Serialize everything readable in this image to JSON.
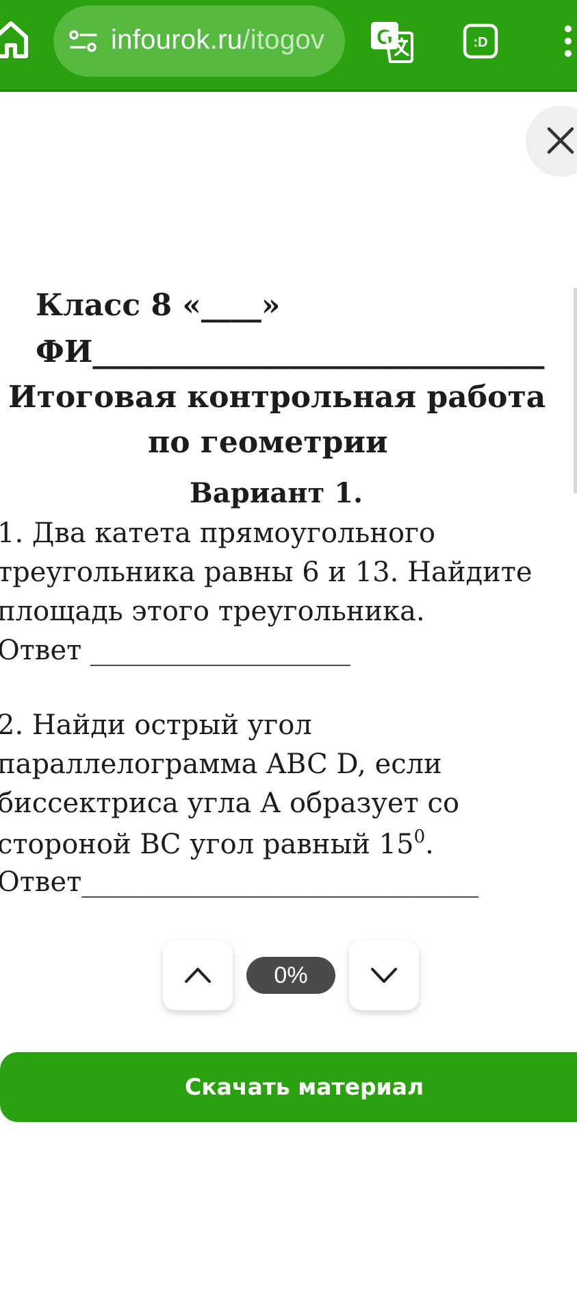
{
  "browser": {
    "url_domain": "infourok.ru",
    "url_path": "/itogov",
    "extension_label": ":D"
  },
  "document": {
    "class_line": "Класс 8 «____»",
    "name_line": "ФИ______________________________",
    "title_line1": "Итоговая контрольная работа",
    "title_line2": "по геометрии",
    "variant": "Вариант 1.",
    "q1_line1": "1.  Два катета прямоугольного",
    "q1_line2": "треугольника равны  6 и  13. Найдите",
    "q1_line3": "площадь этого треугольника.",
    "q1_answer": "Ответ ___________________",
    "q2_line1": "2. Найди  острый угол",
    "q2_line2": "параллелограмма ABC D, если",
    "q2_line3": "биссектриса угла А образует со",
    "q2_line4": "стороной ВС угол равный 15",
    "q2_line4_sup": "0",
    "q2_line4_end": ".",
    "q2_answer": "Ответ_____________________________"
  },
  "viewer": {
    "progress": "0%"
  },
  "actions": {
    "download_label": "Скачать материал"
  },
  "colors": {
    "brand_green": "#2aa10e",
    "urlbar_green": "#56b940",
    "pill_gray": "#4a4a4a"
  },
  "icons": {
    "home": "home-icon",
    "site_settings": "tune-icon",
    "translate": "translate-icon",
    "extension": "extension-icon",
    "menu": "more-vertical-icon",
    "close": "close-icon",
    "up": "chevron-up-icon",
    "down": "chevron-down-icon"
  }
}
